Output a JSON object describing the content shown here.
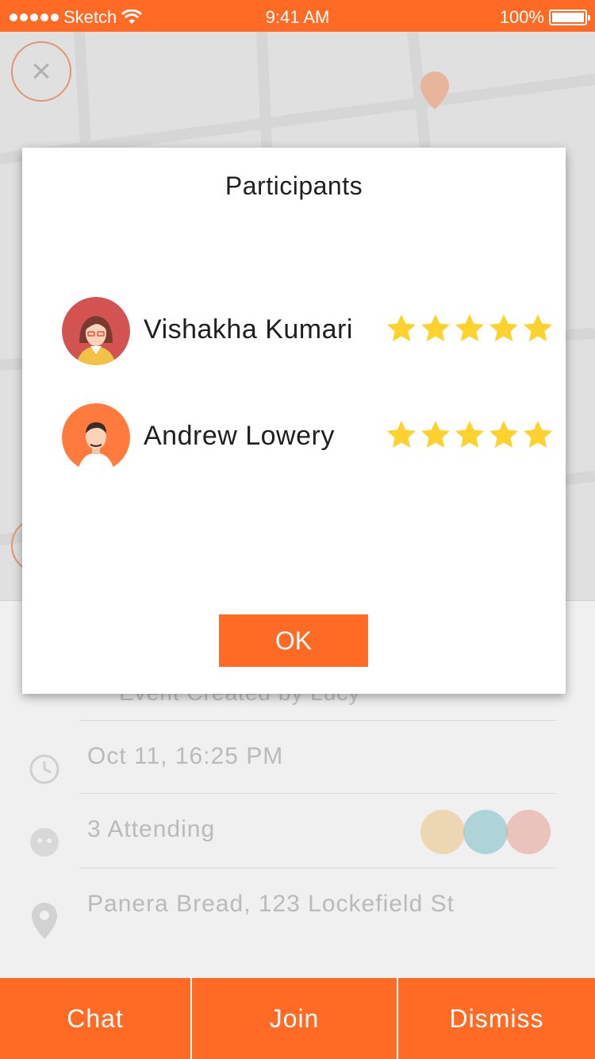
{
  "status_bar": {
    "carrier": "Sketch",
    "time": "9:41 AM",
    "battery": "100%",
    "battery_level": 1.0
  },
  "background": {
    "close_icon": "close-icon",
    "created_text": "Event Created by Lucy",
    "rows": [
      {
        "icon": "clock-icon",
        "text": "Oct 11, 16:25 PM"
      },
      {
        "icon": "attendees-icon",
        "text": "3 Attending"
      },
      {
        "icon": "location-pin-icon",
        "text": "Panera Bread, 123 Lockefield St"
      }
    ]
  },
  "modal": {
    "title": "Participants",
    "participants": [
      {
        "name": "Vishakha Kumari",
        "rating": 5,
        "avatar_color": "#d35353"
      },
      {
        "name": "Andrew Lowery",
        "rating": 5,
        "avatar_color": "#ff7a3d"
      }
    ],
    "ok_label": "OK"
  },
  "bottom_bar": {
    "chat_label": "Chat",
    "join_label": "Join",
    "dismiss_label": "Dismiss"
  },
  "colors": {
    "accent": "#ff6b24",
    "star": "#fdd22f"
  }
}
